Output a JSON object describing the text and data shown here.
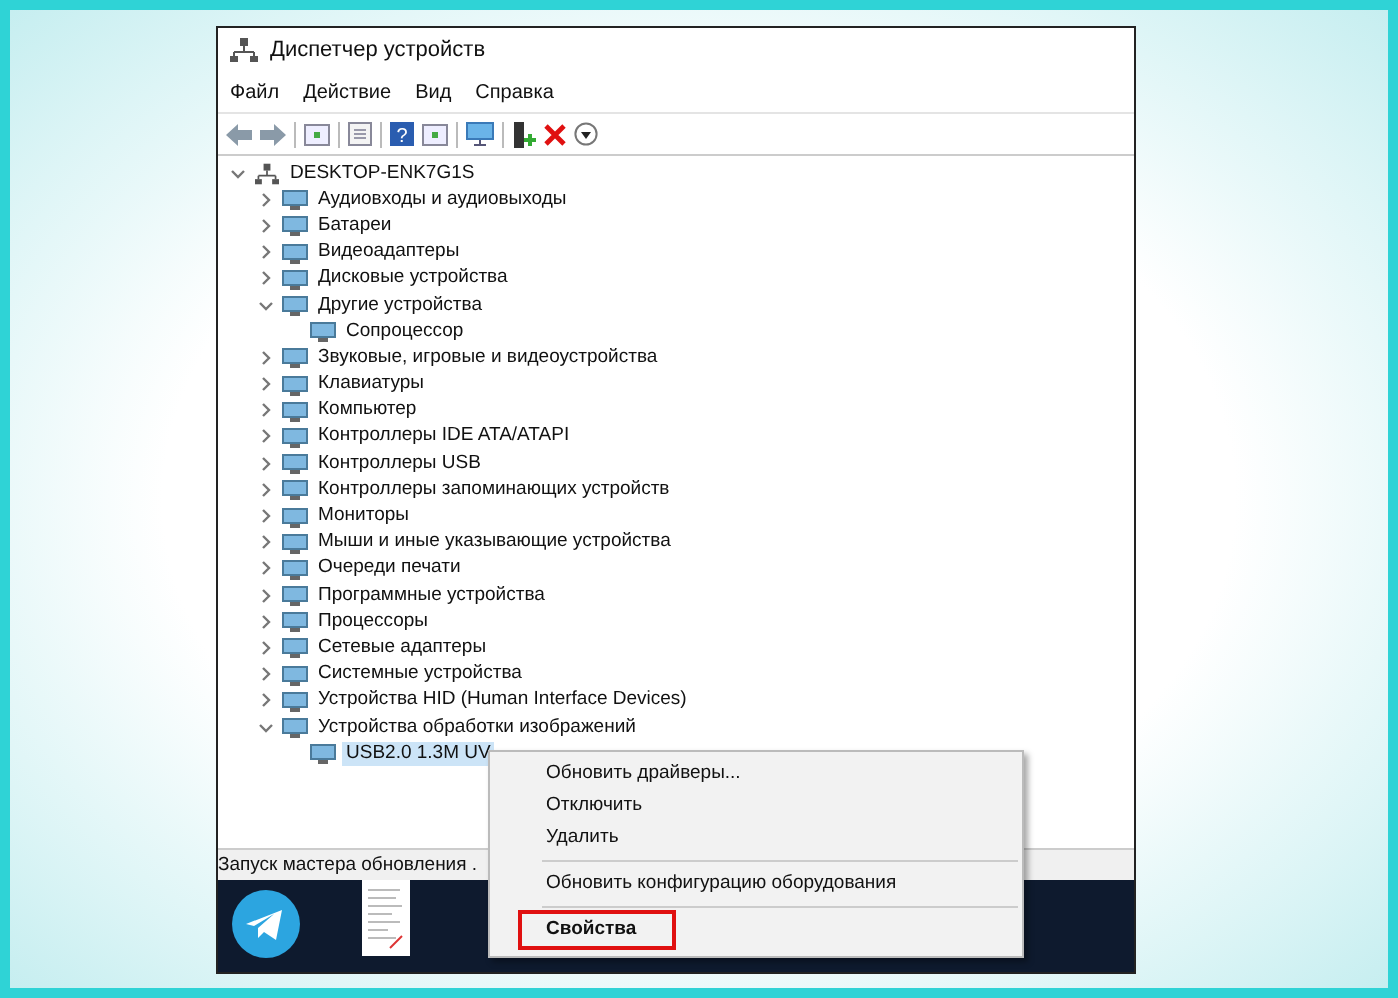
{
  "window": {
    "title": "Диспетчер устройств"
  },
  "menu": [
    "Файл",
    "Действие",
    "Вид",
    "Справка"
  ],
  "toolbar": {
    "help_glyph": "?"
  },
  "tree": [
    {
      "label": "DESKTOP-ENK7G1S",
      "expanded": true,
      "selected": false,
      "children": [
        {
          "label": "Аудиовходы и аудиовыходы",
          "expanded": false,
          "selected": false
        },
        {
          "label": "Батареи",
          "expanded": false,
          "selected": false
        },
        {
          "label": "Видеоадаптеры",
          "expanded": false,
          "selected": false
        },
        {
          "label": "Дисковые устройства",
          "expanded": false,
          "selected": false
        },
        {
          "label": "Другие устройства",
          "expanded": true,
          "selected": false,
          "children": [
            {
              "label": "Сопроцессор",
              "selected": false
            }
          ]
        },
        {
          "label": "Звуковые, игровые и видеоустройства",
          "expanded": false,
          "selected": false
        },
        {
          "label": "Клавиатуры",
          "expanded": false,
          "selected": false
        },
        {
          "label": "Компьютер",
          "expanded": false,
          "selected": false
        },
        {
          "label": "Контроллеры IDE ATA/ATAPI",
          "expanded": false,
          "selected": false
        },
        {
          "label": "Контроллеры USB",
          "expanded": false,
          "selected": false
        },
        {
          "label": "Контроллеры запоминающих устройств",
          "expanded": false,
          "selected": false
        },
        {
          "label": "Мониторы",
          "expanded": false,
          "selected": false
        },
        {
          "label": "Мыши и иные указывающие устройства",
          "expanded": false,
          "selected": false
        },
        {
          "label": "Очереди печати",
          "expanded": false,
          "selected": false
        },
        {
          "label": "Программные устройства",
          "expanded": false,
          "selected": false
        },
        {
          "label": "Процессоры",
          "expanded": false,
          "selected": false
        },
        {
          "label": "Сетевые адаптеры",
          "expanded": false,
          "selected": false
        },
        {
          "label": "Системные устройства",
          "expanded": false,
          "selected": false
        },
        {
          "label": "Устройства HID (Human Interface Devices)",
          "expanded": false,
          "selected": false
        },
        {
          "label": "Устройства обработки изображений",
          "expanded": true,
          "selected": false,
          "children": [
            {
              "label": "USB2.0 1.3M UV",
              "selected": true
            }
          ]
        }
      ]
    }
  ],
  "status_bar": "Запуск мастера обновления .",
  "context_menu": [
    {
      "kind": "item",
      "label": "Обновить драйверы...",
      "bold": false,
      "highlighted": false
    },
    {
      "kind": "item",
      "label": "Отключить",
      "bold": false,
      "highlighted": false
    },
    {
      "kind": "item",
      "label": "Удалить",
      "bold": false,
      "highlighted": false
    },
    {
      "kind": "separator"
    },
    {
      "kind": "item",
      "label": "Обновить конфигурацию оборудования",
      "bold": false,
      "highlighted": false
    },
    {
      "kind": "separator"
    },
    {
      "kind": "item",
      "label": "Свойства",
      "bold": true,
      "highlighted": true
    }
  ]
}
